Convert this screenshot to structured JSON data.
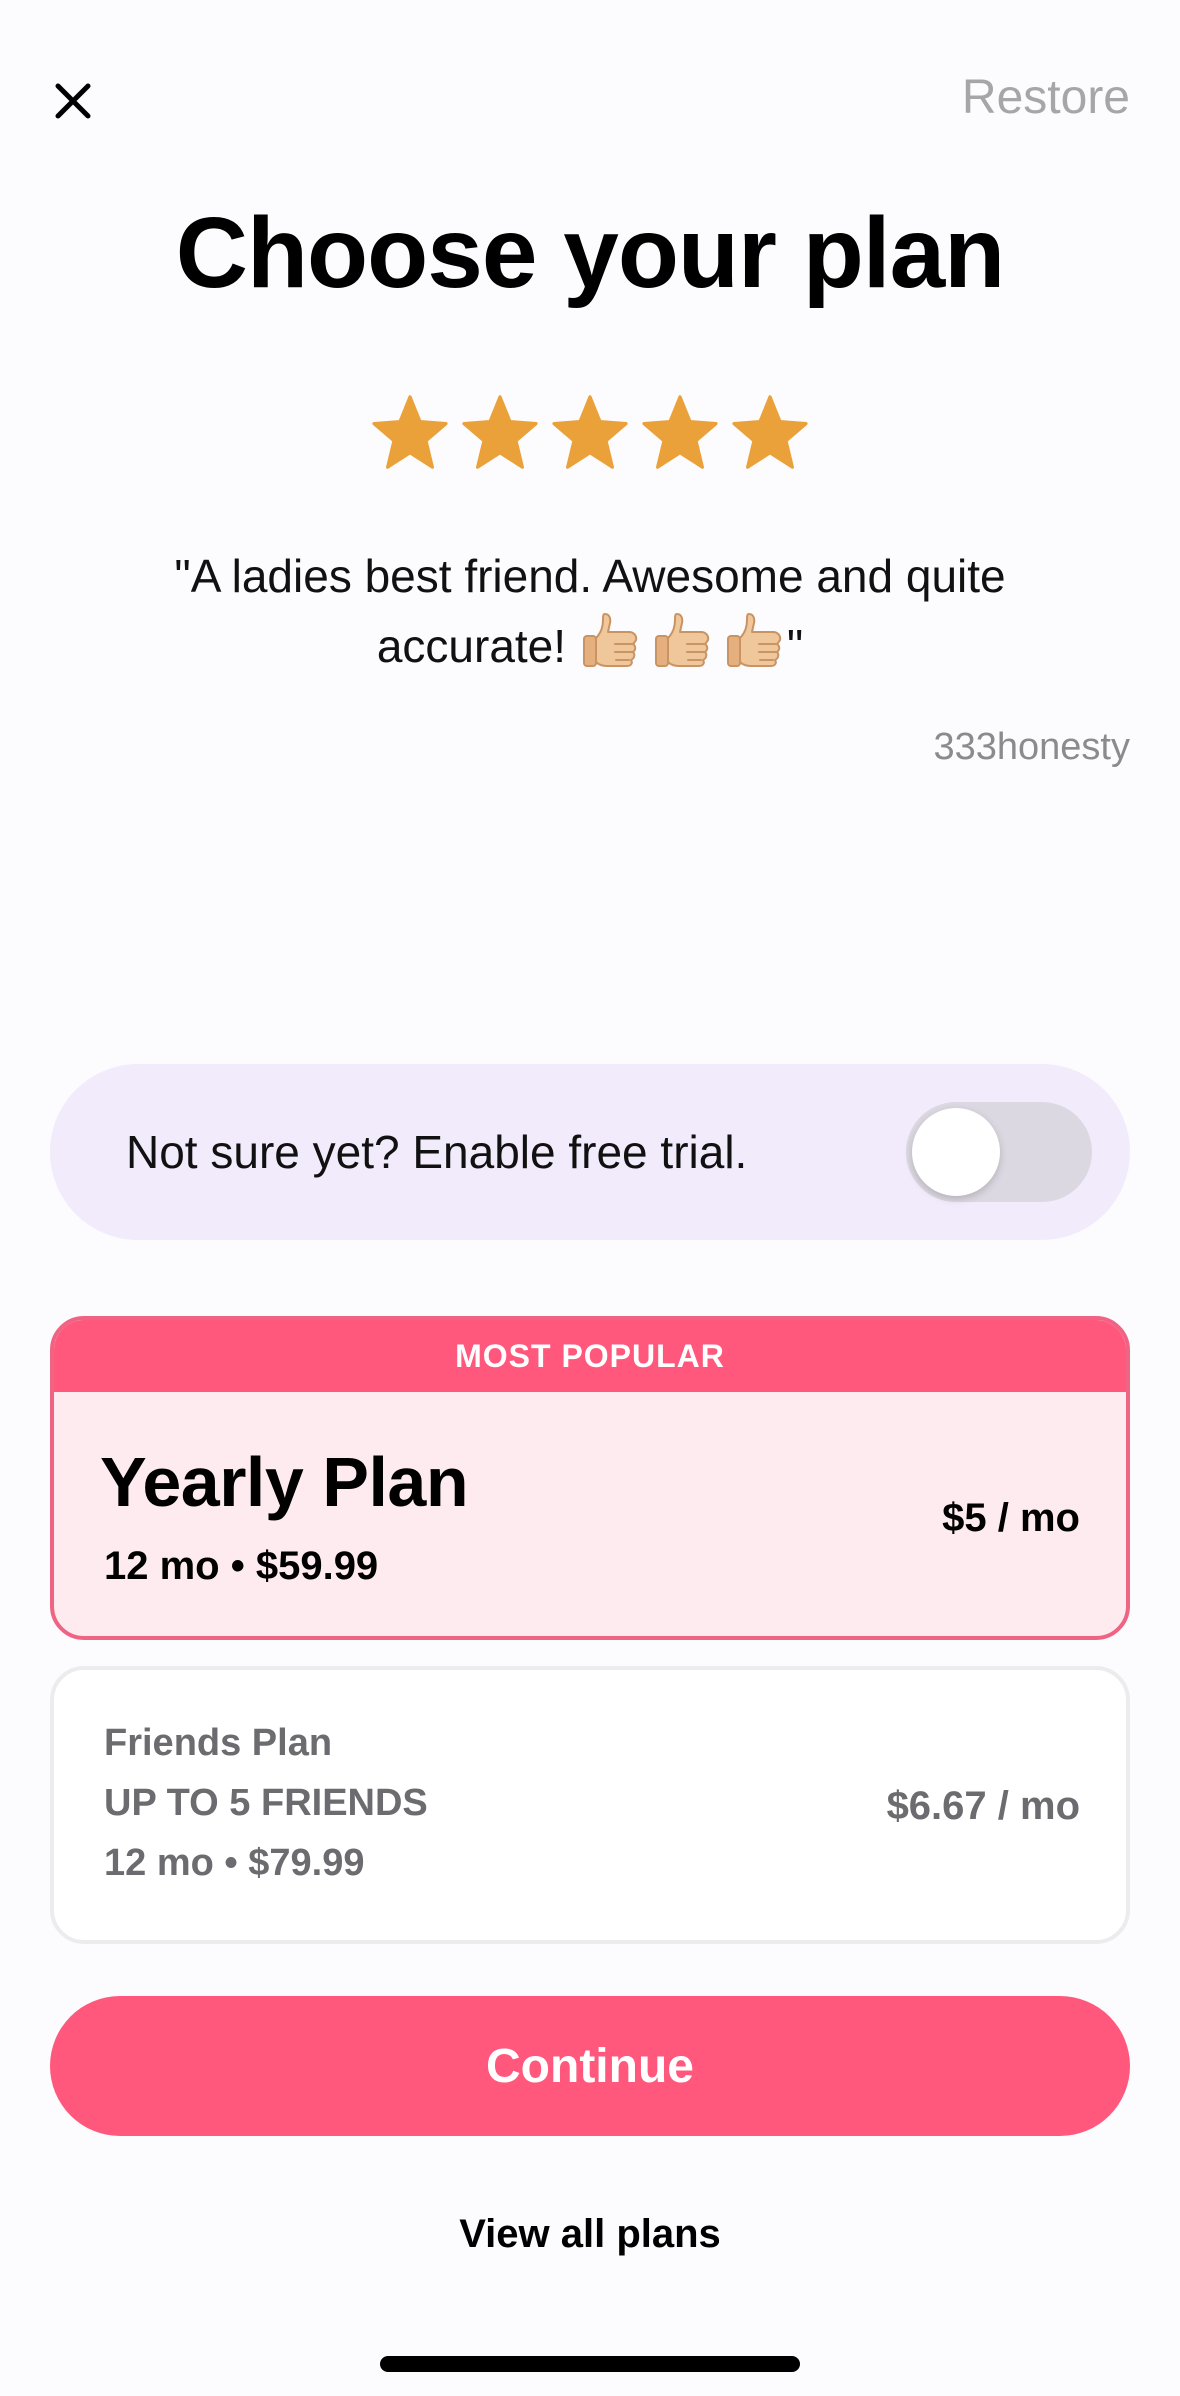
{
  "header": {
    "restore_label": "Restore",
    "title": "Choose your plan"
  },
  "rating": {
    "stars": 5,
    "max_stars": 5,
    "star_color": "#EBA13A"
  },
  "review": {
    "quote_start": "\"A ladies best friend. Awesome and quite accurate!",
    "quote_end": "\"",
    "thumbs_count": 3,
    "author": "333honesty"
  },
  "trial": {
    "label": "Not sure yet? Enable free trial.",
    "enabled": false
  },
  "plans": {
    "yearly": {
      "badge": "MOST POPULAR",
      "name": "Yearly Plan",
      "subtitle": "12 mo • $59.99",
      "monthly_price": "$5 / mo",
      "selected": true
    },
    "friends": {
      "name": "Friends Plan",
      "detail": "UP TO 5 FRIENDS",
      "subtitle": "12 mo • $79.99",
      "monthly_price": "$6.67 / mo",
      "selected": false
    }
  },
  "actions": {
    "continue_label": "Continue",
    "view_all_label": "View all plans"
  },
  "colors": {
    "accent": "#FF587C",
    "trial_bg": "#F2EBFB",
    "selected_bg": "#FDEBF0",
    "muted_text": "#A6A6AA"
  }
}
